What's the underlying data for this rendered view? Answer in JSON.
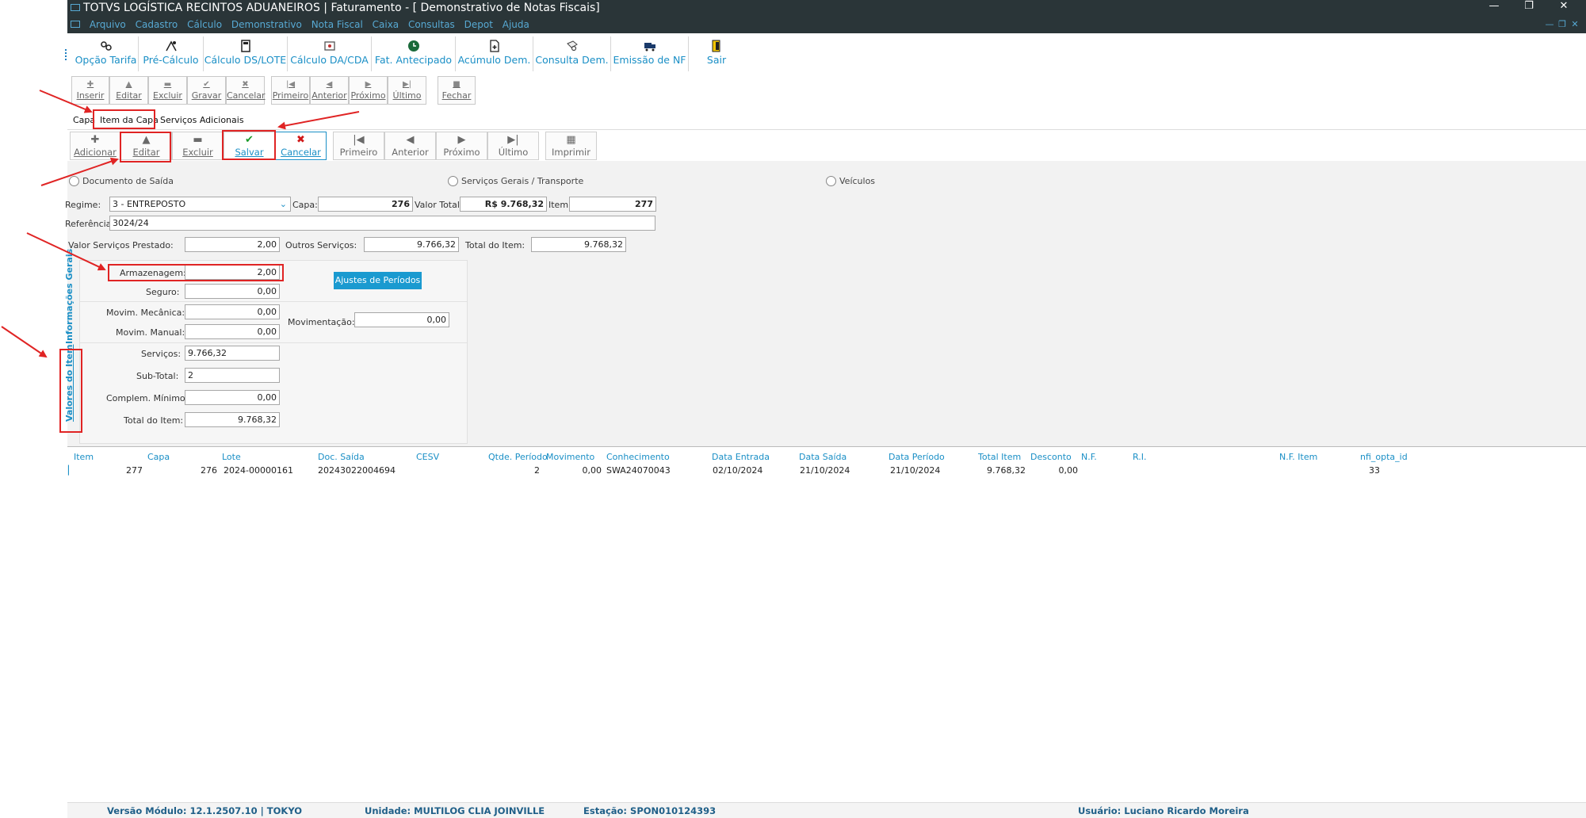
{
  "window": {
    "title": "TOTVS LOGÍSTICA RECINTOS ADUANEIROS | Faturamento - [ Demonstrativo de Notas Fiscais]",
    "menu": [
      "Arquivo",
      "Cadastro",
      "Cálculo",
      "Demonstrativo",
      "Nota Fiscal",
      "Caixa",
      "Consultas",
      "Depot",
      "Ajuda"
    ],
    "controls": {
      "minimize": "—",
      "restore": "❐",
      "close": "✕"
    }
  },
  "main_toolbar": [
    {
      "label": "Opção Tarifa",
      "icon": "tariff-icon"
    },
    {
      "label": "Pré-Cálculo",
      "icon": "precalc-icon"
    },
    {
      "label": "Cálculo DS/LOTE",
      "icon": "calculator-icon"
    },
    {
      "label": "Cálculo DA/CDA",
      "icon": "document-calc-icon"
    },
    {
      "label": "Fat. Antecipado",
      "icon": "clock-icon"
    },
    {
      "label": "Acúmulo Dem.",
      "icon": "document-add-icon"
    },
    {
      "label": "Consulta Dem.",
      "icon": "search-doc-icon"
    },
    {
      "label": "Emissão de NF",
      "icon": "truck-icon"
    },
    {
      "label": "Sair",
      "icon": "exit-icon"
    }
  ],
  "nav_toolbar": {
    "inserir": "Inserir",
    "editar": "Editar",
    "excluir": "Excluir",
    "gravar": "Gravar",
    "cancelar": "Cancelar",
    "primeiro": "Primeiro",
    "anterior": "Anterior",
    "proximo": "Próximo",
    "ultimo": "Último",
    "fechar": "Fechar"
  },
  "tabs": [
    "Capa",
    "Item da Capa",
    "Serviços Adicionais"
  ],
  "item_toolbar": {
    "adicionar": "Adicionar",
    "editar": "Editar",
    "excluir": "Excluir",
    "salvar": "Salvar",
    "cancelar": "Cancelar",
    "primeiro": "Primeiro",
    "anterior": "Anterior",
    "proximo": "Próximo",
    "ultimo": "Último",
    "imprimir": "Imprimir"
  },
  "radios": [
    "Documento de Saída",
    "Serviços Gerais / Transporte",
    "Veículos"
  ],
  "form": {
    "regime_label": "Regime:",
    "regime_value": "3 - ENTREPOSTO",
    "capa_label": "Capa:",
    "capa_value": "276",
    "valor_total_label": "Valor Total:",
    "valor_total_value": "R$ 9.768,32",
    "item_label": "Item:",
    "item_value": "277",
    "referencia_label": "Referência:",
    "referencia_value": "3024/24",
    "valor_servicos_label": "Valor Serviços Prestado:",
    "valor_servicos_value": "2,00",
    "outros_servicos_label": "Outros Serviços:",
    "outros_servicos_value": "9.766,32",
    "total_item_label": "Total do Item:",
    "total_item_value": "9.768,32"
  },
  "side_tabs": {
    "info": "Informações Gerais",
    "valores": "Valores do Item"
  },
  "values": {
    "armazenagem_label": "Armazenagem:",
    "armazenagem_value": "2,00",
    "seguro_label": "Seguro:",
    "seguro_value": "0,00",
    "movim_mecanica_label": "Movim. Mecânica:",
    "movim_mecanica_value": "0,00",
    "movim_manual_label": "Movim. Manual:",
    "movim_manual_value": "0,00",
    "movimentacao_label": "Movimentação:",
    "movimentacao_value": "0,00",
    "ajustes_button": "Ajustes de Períodos",
    "servicos_label": "Serviços:",
    "servicos_value": "9.766,32",
    "subtotal_label": "Sub-Total:",
    "subtotal_value": "2",
    "complem_label": "Complem. Mínimo:",
    "complem_value": "0,00",
    "total_item_label": "Total do Item:",
    "total_item_value": "9.768,32"
  },
  "grid": {
    "headers": [
      "Item",
      "Capa",
      "Lote",
      "Doc. Saída",
      "CESV",
      "Qtde. Período",
      "Movimento",
      "Conhecimento",
      "Data Entrada",
      "Data Saída",
      "Data Período",
      "Total Item",
      "Desconto",
      "N.F.",
      "R.I.",
      "N.F. Item",
      "nfi_opta_id"
    ],
    "row": {
      "item": "277",
      "capa": "276",
      "lote": "2024-00000161",
      "doc_saida": "20243022004694",
      "cesv": "",
      "qtde_periodo": "2",
      "movimento": "0,00",
      "conhecimento": "SWA24070043",
      "data_entrada": "02/10/2024",
      "data_saida": "21/10/2024",
      "data_periodo": "21/10/2024",
      "total_item": "9.768,32",
      "desconto": "0,00",
      "nf": "",
      "ri": "",
      "nf_item": "",
      "nfi_opta_id": "33"
    }
  },
  "status": {
    "versao": "Versão Módulo:  12.1.2507.10  |  TOKYO",
    "unidade": "Unidade:  MULTILOG CLIA JOINVILLE",
    "estacao": "Estação:  SPON010124393",
    "usuario": "Usuário:  Luciano Ricardo Moreira"
  },
  "colors": {
    "accent": "#1a8fc6",
    "titlebar": "#2a3538",
    "annotation": "#e02424"
  }
}
